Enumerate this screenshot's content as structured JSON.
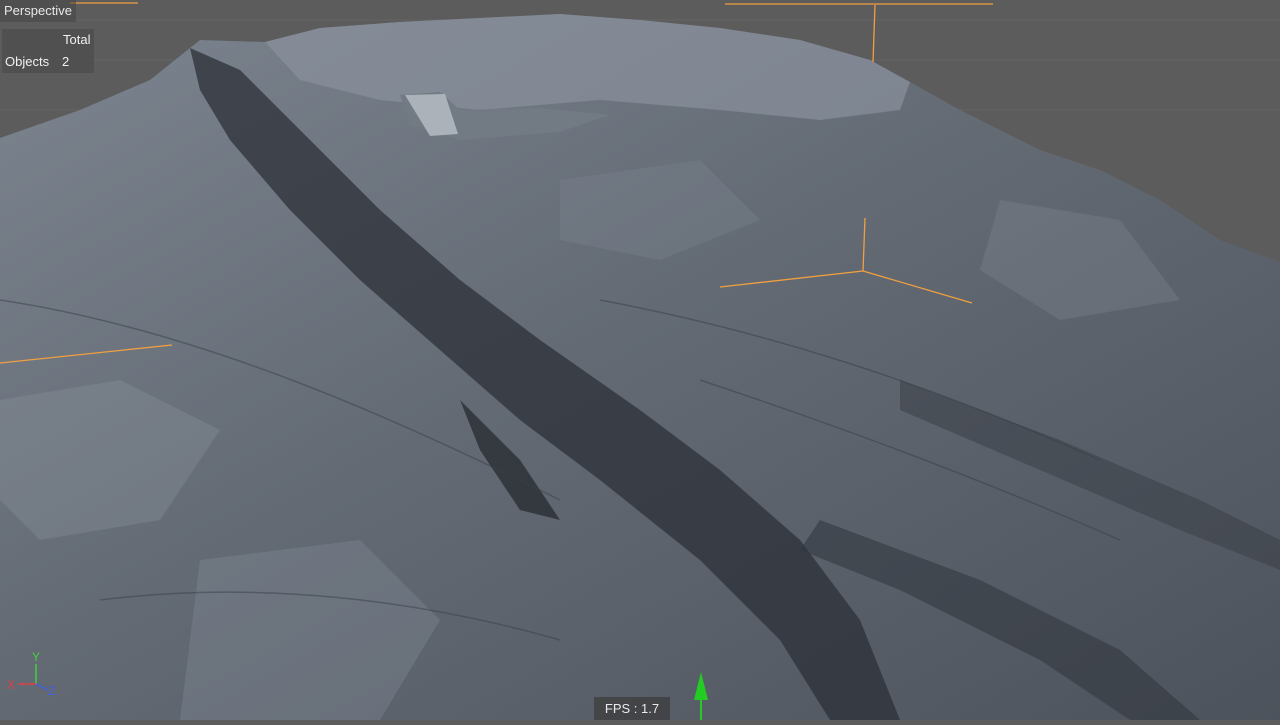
{
  "viewport": {
    "view_name": "Perspective",
    "stats": {
      "column_header": "Total",
      "row_label": "Objects",
      "row_value": "2"
    },
    "fps_text": "FPS : 1.7",
    "axis_gizmo": {
      "x_label": "X",
      "y_label": "Y",
      "z_label": "Z"
    }
  },
  "colors": {
    "background": "#5c5c5c",
    "terrain_light": "#7b838e",
    "terrain_mid": "#5f6670",
    "terrain_dark": "#2a2e35",
    "guide_orange": "#f0a040",
    "gizmo_green": "#22cc22",
    "axis_x": "#e04040",
    "axis_y": "#40d040",
    "axis_z": "#4060e0"
  }
}
